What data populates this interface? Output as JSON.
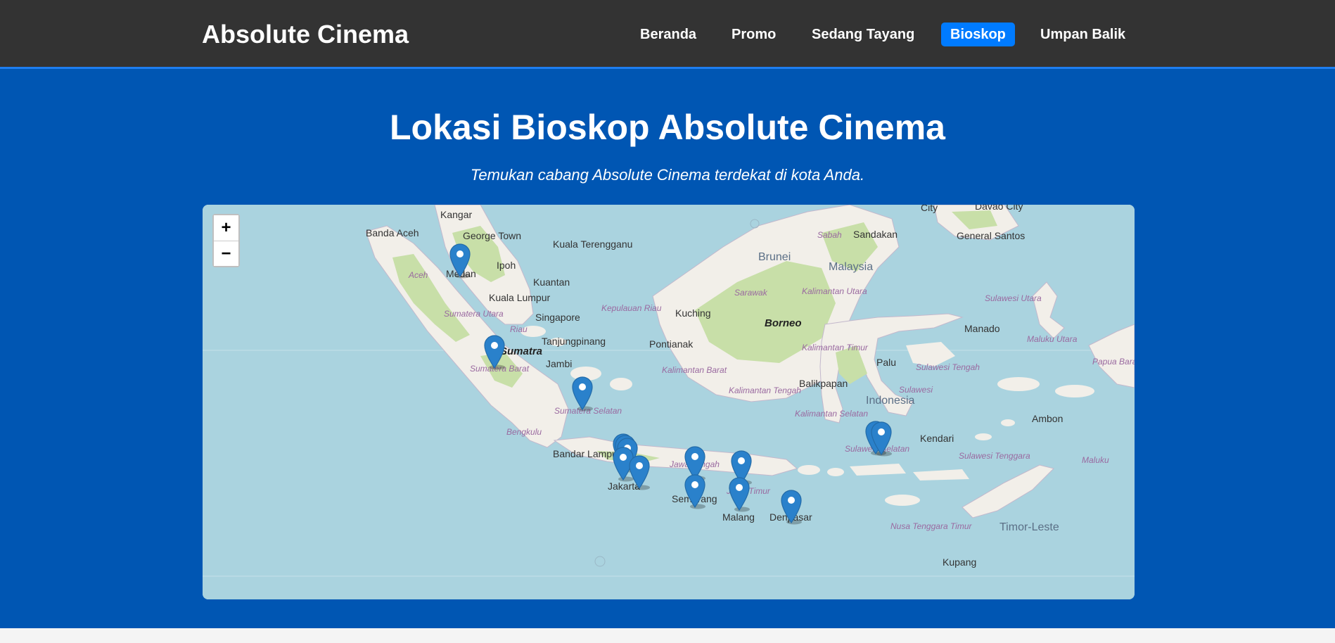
{
  "header": {
    "brand": "Absolute Cinema",
    "nav": [
      {
        "label": "Beranda",
        "active": false
      },
      {
        "label": "Promo",
        "active": false
      },
      {
        "label": "Sedang Tayang",
        "active": false
      },
      {
        "label": "Bioskop",
        "active": true
      },
      {
        "label": "Umpan Balik",
        "active": false
      }
    ]
  },
  "hero": {
    "title": "Lokasi Bioskop Absolute Cinema",
    "subtitle": "Temukan cabang Absolute Cinema terdekat di kota Anda."
  },
  "map": {
    "zoom_in": "+",
    "zoom_out": "−",
    "place_labels": {
      "banda_aceh": "Banda Aceh",
      "kangar": "Kangar",
      "george_town": "George Town",
      "kuala_terengganu": "Kuala Terengganu",
      "ipoh": "Ipoh",
      "aceh": "Aceh",
      "medan": "Medan",
      "kuantan": "Kuantan",
      "kuala_lumpur": "Kuala Lumpur",
      "sumatera_utara": "Sumatera Utara",
      "singapore": "Singapore",
      "kepulauan_riau": "Kepulauan Riau",
      "riau": "Riau",
      "tanjungpinang": "Tanjungpinang",
      "sumatra": "Sumatra",
      "sumatera_barat": "Sumatera Barat",
      "jambi": "Jambi",
      "sumatera_selatan": "Sumatera Selatan",
      "bengkulu": "Bengkulu",
      "bandar_lampung": "Bandar Lampung",
      "jakarta": "Jakarta",
      "jawa_tengah": "Jawa Tengah",
      "semarang": "Semarang",
      "jawa_timur": "Jawa Timur",
      "malang": "Malang",
      "denpasar": "Denpasar",
      "kuching": "Kuching",
      "pontianak": "Pontianak",
      "kalimantan_barat": "Kalimantan Barat",
      "kalimantan_tengah": "Kalimantan Tengah",
      "kalimantan_selatan": "Kalimantan Selatan",
      "kalimantan_timur": "Kalimantan Timur",
      "kalimantan_utara": "Kalimantan Utara",
      "sarawak": "Sarawak",
      "borneo": "Borneo",
      "brunei": "Brunei",
      "malaysia": "Malaysia",
      "sabah": "Sabah",
      "sandakan": "Sandakan",
      "balikpapan": "Balikpapan",
      "palu": "Palu",
      "sulawesi": "Sulawesi",
      "indonesia": "Indonesia",
      "sulawesi_tengah": "Sulawesi Tengah",
      "sulawesi_selatan": "Sulawesi Selatan",
      "kendari": "Kendari",
      "sulawesi_tenggara": "Sulawesi Tenggara",
      "manado": "Manado",
      "sulawesi_utara": "Sulawesi Utara",
      "general_santos": "General Santos",
      "city": "City",
      "davao_city": "Davao City",
      "maluku_utara": "Maluku Utara",
      "papua_barat_daya": "Papua Barat Daya",
      "ambon": "Ambon",
      "maluku": "Maluku",
      "timor_leste": "Timor-Leste",
      "nusa_tenggara_timur": "Nusa Tenggara Timur",
      "kupang": "Kupang"
    },
    "marker_count": 15
  },
  "colors": {
    "header_bg": "#333333",
    "accent": "#007bff",
    "page_bg": "#0056b3",
    "sea": "#aad3df",
    "land": "#f2efe9",
    "forest": "#c8dfa8",
    "marker": "#2a81cb"
  }
}
